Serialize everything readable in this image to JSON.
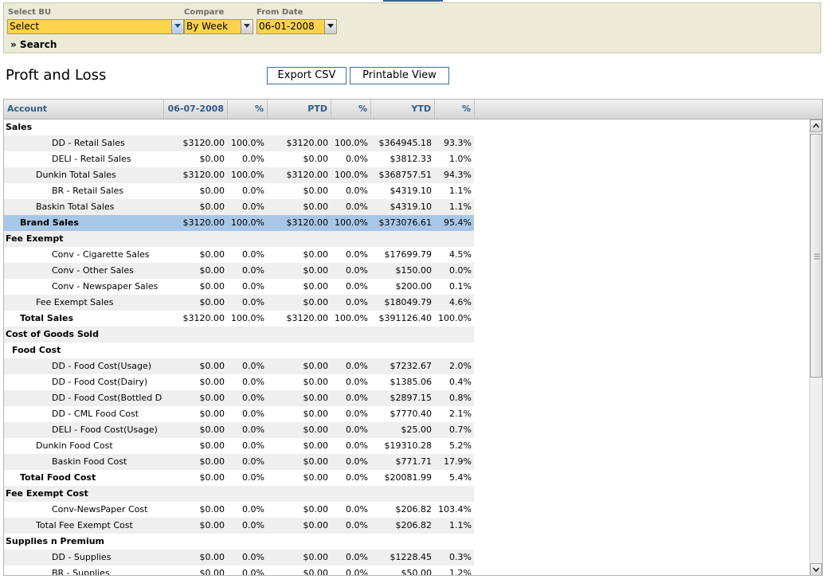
{
  "filters": {
    "select_bu_label": "Select BU",
    "select_bu_value": "Select",
    "compare_label": "Compare",
    "compare_value": "By Week",
    "from_date_label": "From Date",
    "from_date_value": "06-01-2008",
    "search_label": "» Search"
  },
  "page_title": "Proft and Loss",
  "buttons": {
    "export_csv": "Export CSV",
    "printable_view": "Printable View"
  },
  "colors": {
    "highlight_row": "#a8c7e6",
    "header_text": "#2c5b8a",
    "select_bg": "#fdd34b"
  },
  "icons": {
    "dropdown": "chevron-down-icon",
    "scroll_up": "arrow-up-icon",
    "scroll_down": "arrow-down-icon"
  },
  "table": {
    "columns": [
      "Account",
      "06-07-2008",
      "%",
      "PTD",
      "%",
      "YTD",
      "%"
    ],
    "rows": [
      {
        "name": "Sales",
        "level": 0,
        "bold": true,
        "shade": false,
        "cells": []
      },
      {
        "name": "DD - Retail Sales",
        "level": 3,
        "bold": false,
        "shade": true,
        "cells": [
          "$3120.00",
          "100.0%",
          "$3120.00",
          "100.0%",
          "$364945.18",
          "93.3%"
        ]
      },
      {
        "name": "DELI - Retail Sales",
        "level": 3,
        "bold": false,
        "shade": false,
        "cells": [
          "$0.00",
          "0.0%",
          "$0.00",
          "0.0%",
          "$3812.33",
          "1.0%"
        ]
      },
      {
        "name": "Dunkin Total Sales",
        "level": 2,
        "bold": false,
        "shade": true,
        "cells": [
          "$3120.00",
          "100.0%",
          "$3120.00",
          "100.0%",
          "$368757.51",
          "94.3%"
        ]
      },
      {
        "name": "BR - Retail Sales",
        "level": 3,
        "bold": false,
        "shade": false,
        "cells": [
          "$0.00",
          "0.0%",
          "$0.00",
          "0.0%",
          "$4319.10",
          "1.1%"
        ]
      },
      {
        "name": "Baskin Total Sales",
        "level": 2,
        "bold": false,
        "shade": true,
        "cells": [
          "$0.00",
          "0.0%",
          "$0.00",
          "0.0%",
          "$4319.10",
          "1.1%"
        ]
      },
      {
        "name": "Brand Sales",
        "level": 1,
        "bold": true,
        "shade": false,
        "highlight": true,
        "cells": [
          "$3120.00",
          "100.0%",
          "$3120.00",
          "100.0%",
          "$373076.61",
          "95.4%"
        ]
      },
      {
        "name": "Fee Exempt",
        "level": 0,
        "bold": true,
        "shade": true,
        "cells": []
      },
      {
        "name": "Conv - Cigarette Sales",
        "level": 3,
        "bold": false,
        "shade": false,
        "cells": [
          "$0.00",
          "0.0%",
          "$0.00",
          "0.0%",
          "$17699.79",
          "4.5%"
        ]
      },
      {
        "name": "Conv - Other Sales",
        "level": 3,
        "bold": false,
        "shade": true,
        "cells": [
          "$0.00",
          "0.0%",
          "$0.00",
          "0.0%",
          "$150.00",
          "0.0%"
        ]
      },
      {
        "name": "Conv - Newspaper Sales",
        "level": 3,
        "bold": false,
        "shade": false,
        "cells": [
          "$0.00",
          "0.0%",
          "$0.00",
          "0.0%",
          "$200.00",
          "0.1%"
        ]
      },
      {
        "name": "Fee Exempt Sales",
        "level": 2,
        "bold": false,
        "shade": true,
        "cells": [
          "$0.00",
          "0.0%",
          "$0.00",
          "0.0%",
          "$18049.79",
          "4.6%"
        ]
      },
      {
        "name": "Total Sales",
        "level": 1,
        "bold": true,
        "shade": false,
        "cells": [
          "$3120.00",
          "100.0%",
          "$3120.00",
          "100.0%",
          "$391126.40",
          "100.0%"
        ]
      },
      {
        "name": "Cost of Goods Sold",
        "level": 0,
        "bold": true,
        "shade": true,
        "cells": []
      },
      {
        "name": "Food Cost",
        "level": 0.5,
        "bold": true,
        "shade": false,
        "cells": []
      },
      {
        "name": "DD - Food Cost(Usage)",
        "level": 3,
        "bold": false,
        "shade": true,
        "cells": [
          "$0.00",
          "0.0%",
          "$0.00",
          "0.0%",
          "$7232.67",
          "2.0%"
        ]
      },
      {
        "name": "DD - Food Cost(Dairy)",
        "level": 3,
        "bold": false,
        "shade": false,
        "cells": [
          "$0.00",
          "0.0%",
          "$0.00",
          "0.0%",
          "$1385.06",
          "0.4%"
        ]
      },
      {
        "name": "DD - Food Cost(Bottled Drinks",
        "level": 3,
        "bold": false,
        "shade": true,
        "cells": [
          "$0.00",
          "0.0%",
          "$0.00",
          "0.0%",
          "$2897.15",
          "0.8%"
        ]
      },
      {
        "name": "DD - CML Food Cost",
        "level": 3,
        "bold": false,
        "shade": false,
        "cells": [
          "$0.00",
          "0.0%",
          "$0.00",
          "0.0%",
          "$7770.40",
          "2.1%"
        ]
      },
      {
        "name": "DELI - Food Cost(Usage)",
        "level": 3,
        "bold": false,
        "shade": true,
        "cells": [
          "$0.00",
          "0.0%",
          "$0.00",
          "0.0%",
          "$25.00",
          "0.7%"
        ]
      },
      {
        "name": "Dunkin Food Cost",
        "level": 2,
        "bold": false,
        "shade": false,
        "cells": [
          "$0.00",
          "0.0%",
          "$0.00",
          "0.0%",
          "$19310.28",
          "5.2%"
        ]
      },
      {
        "name": "Baskin Food Cost",
        "level": 3,
        "bold": false,
        "shade": true,
        "cells": [
          "$0.00",
          "0.0%",
          "$0.00",
          "0.0%",
          "$771.71",
          "17.9%"
        ]
      },
      {
        "name": "Total Food Cost",
        "level": 1,
        "bold": true,
        "shade": false,
        "cells": [
          "$0.00",
          "0.0%",
          "$0.00",
          "0.0%",
          "$20081.99",
          "5.4%"
        ]
      },
      {
        "name": "Fee Exempt Cost",
        "level": 0,
        "bold": true,
        "shade": true,
        "cells": []
      },
      {
        "name": "Conv-NewsPaper Cost",
        "level": 3,
        "bold": false,
        "shade": false,
        "cells": [
          "$0.00",
          "0.0%",
          "$0.00",
          "0.0%",
          "$206.82",
          "103.4%"
        ]
      },
      {
        "name": "Total Fee Exempt Cost",
        "level": 2,
        "bold": false,
        "shade": true,
        "cells": [
          "$0.00",
          "0.0%",
          "$0.00",
          "0.0%",
          "$206.82",
          "1.1%"
        ]
      },
      {
        "name": "Supplies n Premium",
        "level": 0,
        "bold": true,
        "shade": false,
        "cells": []
      },
      {
        "name": "DD - Supplies",
        "level": 3,
        "bold": false,
        "shade": true,
        "cells": [
          "$0.00",
          "0.0%",
          "$0.00",
          "0.0%",
          "$1228.45",
          "0.3%"
        ]
      },
      {
        "name": "BR - Supplies",
        "level": 3,
        "bold": false,
        "shade": false,
        "cells": [
          "$0.00",
          "0.0%",
          "$0.00",
          "0.0%",
          "$50.00",
          "1.2%"
        ]
      }
    ]
  }
}
